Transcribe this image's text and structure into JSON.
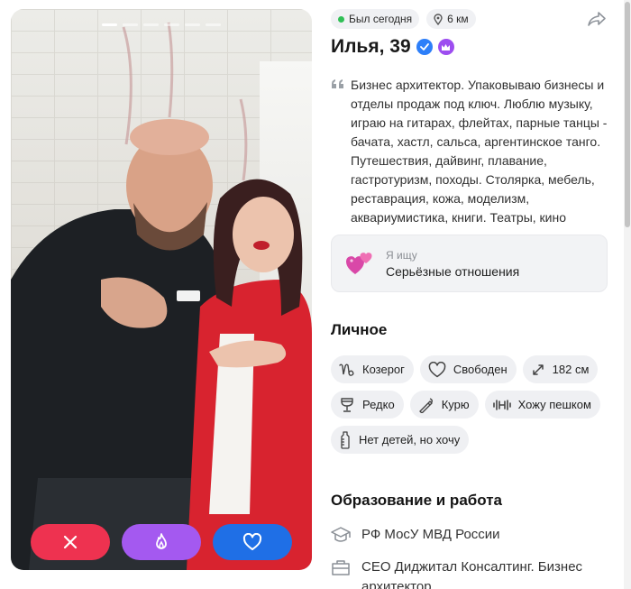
{
  "photo": {
    "total_photos": 6,
    "active_index": 0
  },
  "actions": {
    "dislike_icon": "close-icon",
    "superlike_icon": "flame-icon",
    "like_icon": "heart-icon",
    "colors": {
      "dislike": "#ee3250",
      "superlike": "#a459f0",
      "like": "#1f6fe6"
    }
  },
  "status": {
    "online_text": "Был сегодня",
    "distance_text": "6 км"
  },
  "profile": {
    "name_age": "Илья, 39",
    "bio": "Бизнес архитектор. Упаковываю бизнесы и отделы продаж под ключ. Люблю музыку, играю на гитарах, флейтах, парные танцы - бачата, хастл, сальса, аргентинское танго. Путешествия, дайвинг, плавание, гастротуризм, походы. Столярка, мебель, реставрация, кожа, моделизм, аквариумистика, книги. Театры, кино"
  },
  "looking_for": {
    "label": "Я ищу",
    "value": "Серьёзные отношения"
  },
  "personal": {
    "title": "Личное",
    "tags": [
      {
        "icon": "capricorn-icon",
        "label": "Козерог"
      },
      {
        "icon": "heart-outline-icon",
        "label": "Свободен"
      },
      {
        "icon": "height-arrows-icon",
        "label": "182 см"
      },
      {
        "icon": "wine-glass-icon",
        "label": "Редко"
      },
      {
        "icon": "cigarette-icon",
        "label": "Курю"
      },
      {
        "icon": "dumbbell-icon",
        "label": "Хожу пешком"
      },
      {
        "icon": "baby-bottle-icon",
        "label": "Нет детей, но хочу"
      }
    ]
  },
  "education_work": {
    "title": "Образование и работа",
    "items": [
      {
        "icon": "graduation-cap-icon",
        "text": "РФ МосУ МВД России"
      },
      {
        "icon": "briefcase-icon",
        "text": "CEO Диджитал Консалтинг. Бизнес архитектор"
      }
    ]
  }
}
